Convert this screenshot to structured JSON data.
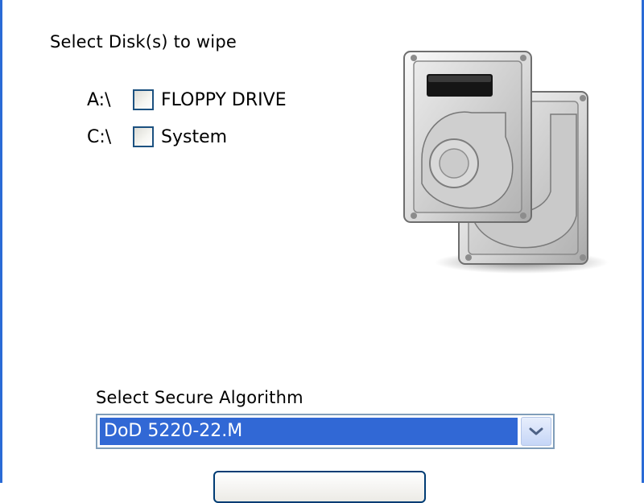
{
  "disks": {
    "section_label": "Select Disk(s) to wipe",
    "items": [
      {
        "letter": "A:\\",
        "name": "FLOPPY DRIVE",
        "checked": false
      },
      {
        "letter": "C:\\",
        "name": "System",
        "checked": false
      }
    ],
    "image_icon": "hard-disk-drives-icon"
  },
  "algorithm": {
    "label": "Select Secure Algorithm",
    "selected": "DoD 5220-22.M",
    "arrow_icon": "chevron-down-icon",
    "selection_color": "#3168d5"
  },
  "bottom_button": {
    "label": ""
  },
  "colors": {
    "window_border": "#2a6bd6",
    "checkbox_border": "#1c5180",
    "select_border": "#7f9db9"
  }
}
